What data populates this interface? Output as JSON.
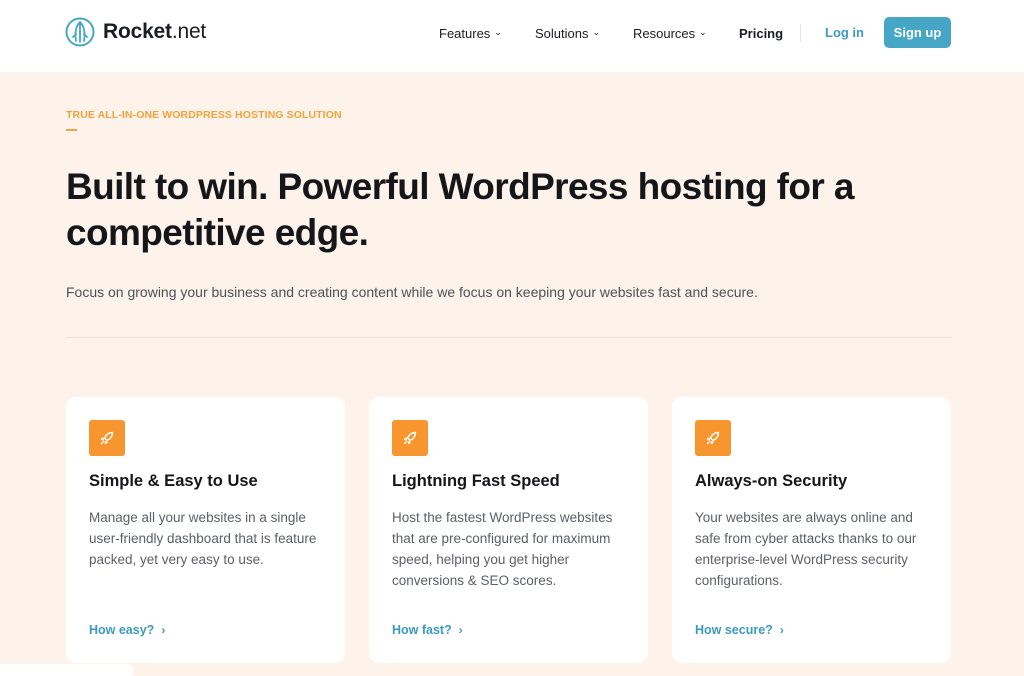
{
  "brand": {
    "name_bold": "Rocket",
    "name_rest": ".net"
  },
  "nav": {
    "features": "Features",
    "solutions": "Solutions",
    "resources": "Resources",
    "pricing": "Pricing",
    "login": "Log in",
    "signup": "Sign up"
  },
  "hero": {
    "eyebrow": "TRUE ALL-IN-ONE WORDPRESS HOSTING SOLUTION",
    "headline": "Built to win. Powerful WordPress hosting for a competitive edge.",
    "subheadline": "Focus on growing your business and creating content while we focus on keeping your websites fast and secure."
  },
  "cards": [
    {
      "title": "Simple & Easy to Use",
      "description": "Manage all your websites in a single user-friendly dashboard that is feature packed, yet very easy to use.",
      "link": "How easy?",
      "icon": "rocket-icon"
    },
    {
      "title": "Lightning Fast Speed",
      "description": "Host the fastest WordPress websites that are pre-configured for maximum speed, helping you get higher conversions & SEO scores.",
      "link": "How fast?",
      "icon": "rocket-icon"
    },
    {
      "title": "Always-on Security",
      "description": "Your websites are always online and safe from cyber attacks thanks to our enterprise-level WordPress security configurations.",
      "link": "How secure?",
      "icon": "rocket-icon"
    }
  ],
  "colors": {
    "background": "#fdf3ea",
    "accent_blue": "#45a6c6",
    "accent_orange": "#f7952e",
    "eyebrow_orange": "#f2a23a"
  }
}
